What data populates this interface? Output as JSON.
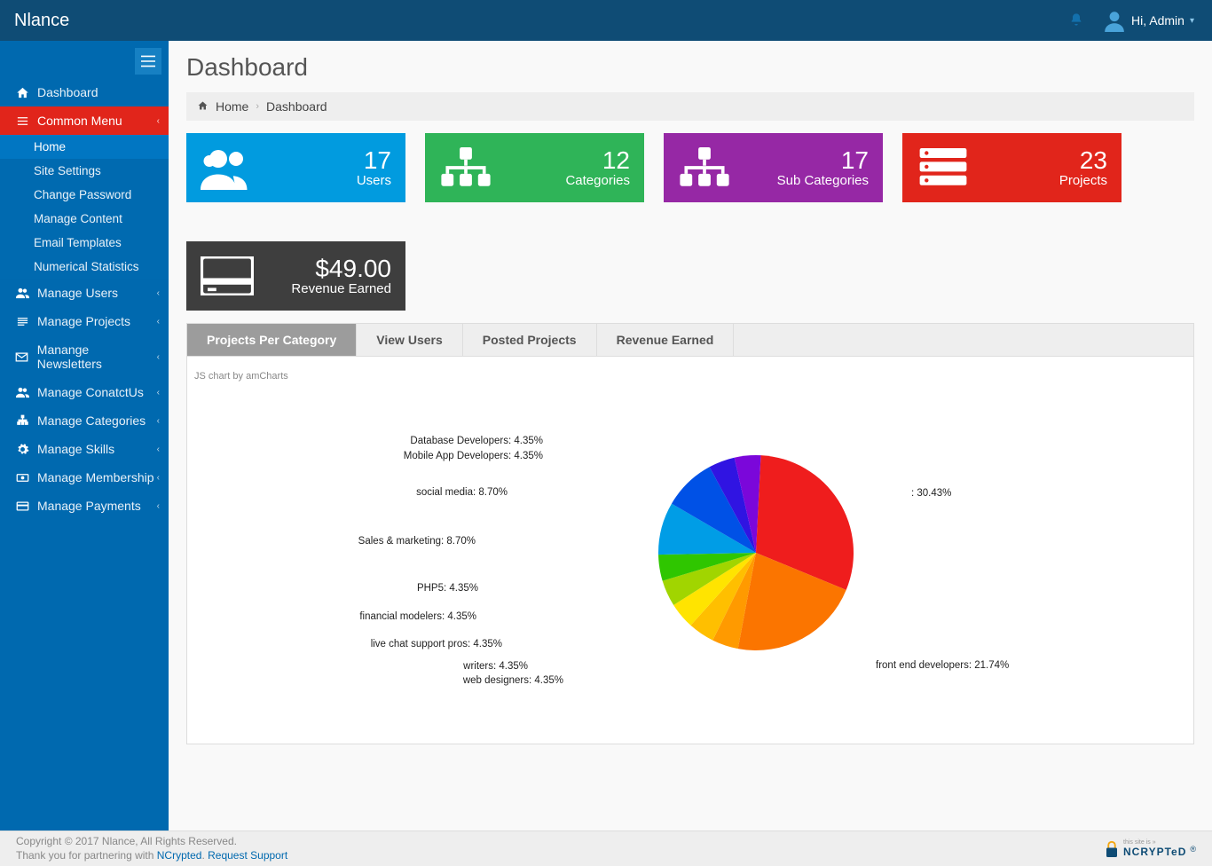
{
  "brand": "Nlance",
  "header": {
    "greeting": "Hi, Admin"
  },
  "sidebar": {
    "toggle_icon": "menu-icon",
    "items": [
      {
        "icon": "home-icon",
        "label": "Dashboard"
      },
      {
        "icon": "list-icon",
        "label": "Common Menu",
        "sub": [
          {
            "label": "Home",
            "current": true
          },
          {
            "label": "Site Settings"
          },
          {
            "label": "Change Password"
          },
          {
            "label": "Manage Content"
          },
          {
            "label": "Email Templates"
          },
          {
            "label": "Numerical Statistics"
          }
        ]
      },
      {
        "icon": "users-icon",
        "label": "Manage Users"
      },
      {
        "icon": "projects-icon",
        "label": "Manage Projects"
      },
      {
        "icon": "envelope-icon",
        "label": "Manange Newsletters"
      },
      {
        "icon": "users-icon",
        "label": "Manage ConatctUs"
      },
      {
        "icon": "sitemap-icon",
        "label": "Manage Categories"
      },
      {
        "icon": "gear-icon",
        "label": "Manage Skills"
      },
      {
        "icon": "cash-icon",
        "label": "Manage Membership"
      },
      {
        "icon": "card-icon",
        "label": "Manage Payments"
      }
    ]
  },
  "page": {
    "title": "Dashboard",
    "breadcrumb_home": "Home",
    "breadcrumb_current": "Dashboard"
  },
  "stats": [
    {
      "value": "17",
      "label": "Users",
      "color": "c-blue",
      "icon": "users"
    },
    {
      "value": "12",
      "label": "Categories",
      "color": "c-green",
      "icon": "sitemap"
    },
    {
      "value": "17",
      "label": "Sub Categories",
      "color": "c-purple",
      "icon": "sitemap"
    },
    {
      "value": "23",
      "label": "Projects",
      "color": "c-red",
      "icon": "server"
    },
    {
      "value": "$49.00",
      "label": "Revenue Earned",
      "color": "c-dark",
      "icon": "creditcard"
    }
  ],
  "tabs": [
    {
      "label": "Projects Per Category",
      "active": true
    },
    {
      "label": "View Users"
    },
    {
      "label": "Posted Projects"
    },
    {
      "label": "Revenue Earned"
    }
  ],
  "chart_credit": "JS chart by amCharts",
  "chart_data": {
    "type": "pie",
    "title": "",
    "series": [
      {
        "name": "",
        "value": 30.43,
        "color": "#ef1d1d"
      },
      {
        "name": "front end developers",
        "value": 21.74,
        "color": "#fb7500"
      },
      {
        "name": "web designers",
        "value": 4.35,
        "color": "#ff9a00"
      },
      {
        "name": "writers",
        "value": 4.35,
        "color": "#ffbf00"
      },
      {
        "name": "live chat support pros",
        "value": 4.35,
        "color": "#ffe400"
      },
      {
        "name": "financial modelers",
        "value": 4.35,
        "color": "#a1d500"
      },
      {
        "name": "PHP5",
        "value": 4.35,
        "color": "#2fc600"
      },
      {
        "name": "Sales & marketing",
        "value": 8.7,
        "color": "#009de6"
      },
      {
        "name": "social media",
        "value": 8.7,
        "color": "#0051e6"
      },
      {
        "name": "Mobile App Developers",
        "value": 4.35,
        "color": "#3014e2"
      },
      {
        "name": "Database Developers",
        "value": 4.35,
        "color": "#7b07da"
      }
    ],
    "label_format": "{name}: {value}%"
  },
  "footer": {
    "line1": "Copyright © 2017 Nlance, All Rights Reserved.",
    "line2a": "Thank you for partnering with ",
    "line2b": "NCrypted",
    "line2c": ". ",
    "line2d": "Request Support",
    "badge_top": "this site is »",
    "badge_brand": "NCRYPTeD"
  }
}
